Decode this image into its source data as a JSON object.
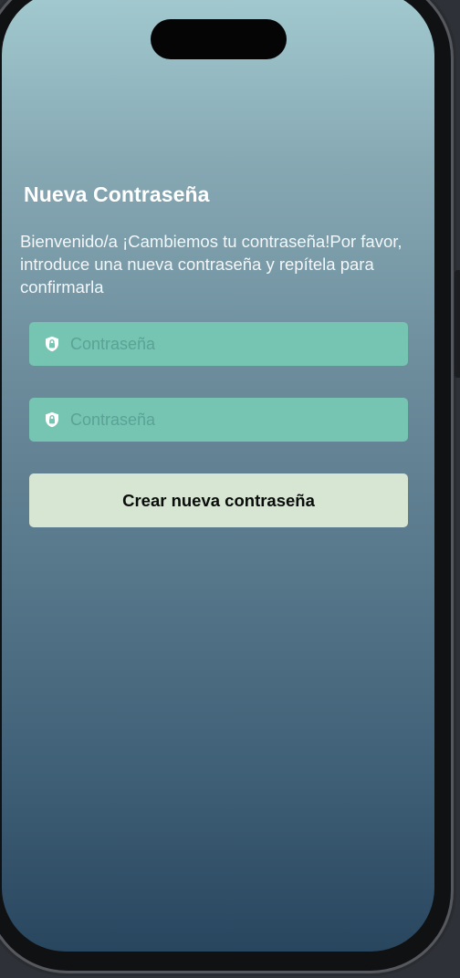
{
  "screen": {
    "title": "Nueva Contraseña",
    "subtitle": "Bienvenido/a ¡Cambiemos tu contraseña!Por favor, introduce una nueva contraseña y repítela para confirmarla"
  },
  "form": {
    "password": {
      "placeholder": "Contraseña",
      "value": "",
      "icon": "lock-shield-icon"
    },
    "confirm_password": {
      "placeholder": "Contraseña",
      "value": "",
      "icon": "lock-shield-icon"
    },
    "submit_label": "Crear nueva contraseña"
  },
  "colors": {
    "gradient_top": "#a3cad0",
    "gradient_bottom": "#29465f",
    "field_background": "#76c4b2",
    "placeholder": "#5aa396",
    "button_background": "#d6e6d2",
    "title_text": "#ffffff"
  }
}
